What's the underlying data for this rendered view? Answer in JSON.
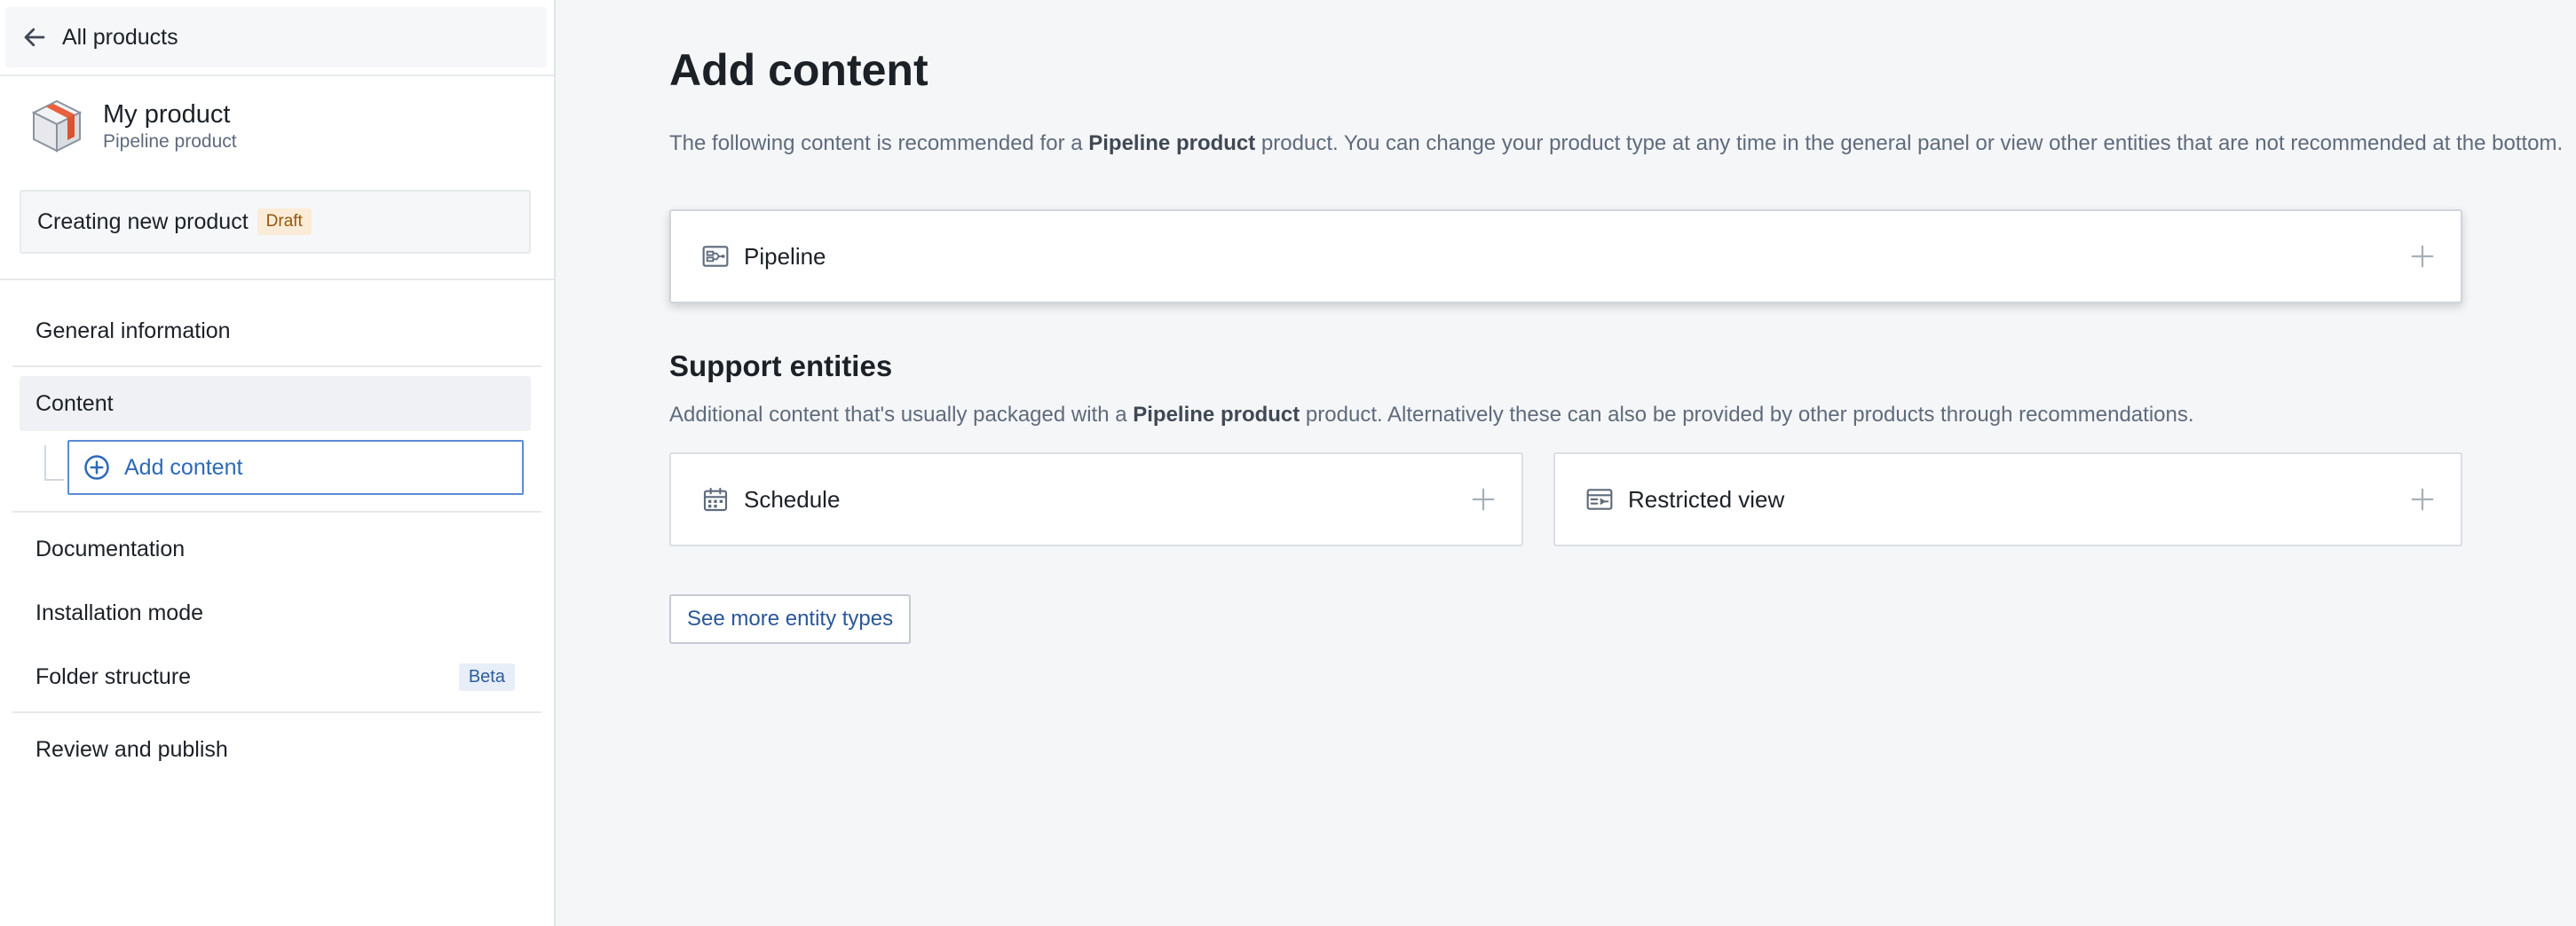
{
  "sidebar": {
    "back_label": "All products",
    "product": {
      "name": "My product",
      "type": "Pipeline product"
    },
    "status": {
      "label": "Creating new product",
      "badge": "Draft"
    },
    "nav": {
      "general": "General information",
      "content": "Content",
      "add_content": "Add content",
      "documentation": "Documentation",
      "installation": "Installation mode",
      "folder": "Folder structure",
      "folder_badge": "Beta",
      "review": "Review and publish"
    }
  },
  "main": {
    "title": "Add content",
    "desc_prefix": "The following content is recommended for a ",
    "desc_bold": "Pipeline product",
    "desc_suffix": " product. You can change your product type at any time in the general panel or view other entities that are not recommended at the bottom.",
    "recommended": [
      {
        "name": "Pipeline",
        "icon": "pipeline-icon"
      }
    ],
    "support": {
      "title": "Support entities",
      "desc_prefix": "Additional content that's usually packaged with a ",
      "desc_bold": "Pipeline product",
      "desc_suffix": " product. Alternatively these can also be provided by other products through recommendations.",
      "entities": [
        {
          "name": "Schedule",
          "icon": "calendar-icon"
        },
        {
          "name": "Restricted view",
          "icon": "restricted-view-icon"
        }
      ]
    },
    "more_button": "See more entity types"
  },
  "colors": {
    "accent": "#2b6ab8",
    "draft_badge": "#fbecd7",
    "beta_badge": "#e7eef8"
  }
}
